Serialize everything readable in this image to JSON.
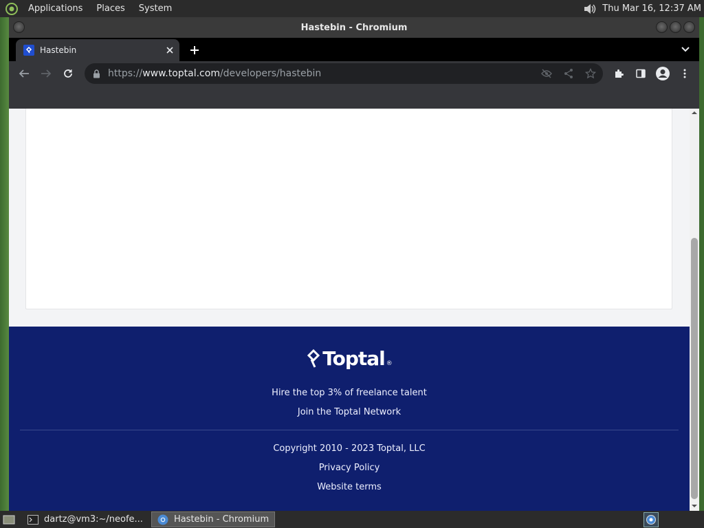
{
  "top_panel": {
    "menus": [
      "Applications",
      "Places",
      "System"
    ],
    "clock": "Thu Mar 16, 12:37 AM"
  },
  "window": {
    "title": "Hastebin - Chromium"
  },
  "tab": {
    "title": "Hastebin"
  },
  "omnibox": {
    "url_scheme": "https://",
    "url_host": "www.toptal.com",
    "url_path": "/developers/hastebin"
  },
  "footer": {
    "brand": "Toptal",
    "brand_mark": "®",
    "links": [
      "Hire the top 3% of freelance talent",
      "Join the Toptal Network"
    ],
    "copyright": "Copyright 2010 - 2023 Toptal, LLC",
    "legal_links": [
      "Privacy Policy",
      "Website terms"
    ]
  },
  "taskbar": {
    "tasks": [
      "dartz@vm3:~/neofe...",
      "Hastebin - Chromium"
    ]
  },
  "colors": {
    "footer_bg": "#0f1f6e",
    "tab_favicon": "#204ecf",
    "chrome_dark": "#35363a"
  }
}
